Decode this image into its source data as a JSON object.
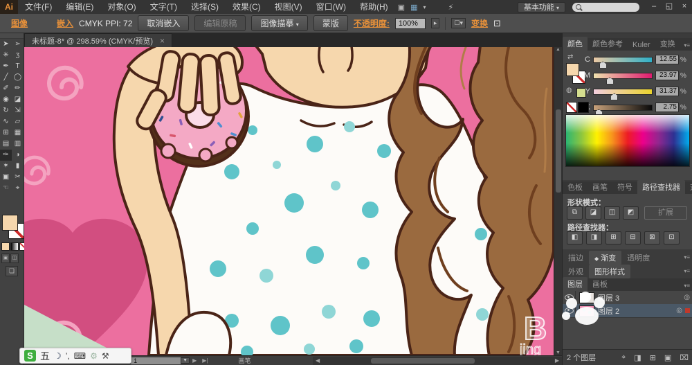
{
  "theme": {
    "bg-menubar": "#343434",
    "bg-controlbar": "#4e4e4e",
    "bg-toolbar": "#424242",
    "bg-panel": "#464646",
    "bg-canvas-frame": "#2b2b2b",
    "accent-orange": "#e8913a",
    "text-light": "#d6d6d6",
    "selection-blue": "#4a5866",
    "ill-pink": "#ec6f9f",
    "ill-pink-light": "#f4a3c0",
    "ill-pink-deep": "#d24e80",
    "ill-mint": "#c6dfc8",
    "ill-skin": "#f6d7ad",
    "ill-outline": "#4a2417",
    "ill-choco": "#53301a",
    "ill-frosting": "#f4a9c5",
    "ill-teal": "#5fc4c9",
    "ill-hair": "#9a6a3f",
    "ill-hair-dark": "#6f3f1f",
    "ill-hair-light": "#b07c48"
  },
  "titlebar": {
    "logo": "Ai",
    "menus": [
      "文件(F)",
      "编辑(E)",
      "对象(O)",
      "文字(T)",
      "选择(S)",
      "效果(C)",
      "视图(V)",
      "窗口(W)",
      "帮助(H)"
    ],
    "launch_bridge_icon": "▣",
    "arrange_documents_icon": "▦",
    "arrange_caret": "▾",
    "performance_icon": "⚡",
    "workspace": "基本功能",
    "workspace_caret": "▾",
    "minimize": "–",
    "restore": "◱",
    "close": "×"
  },
  "controlbar": {
    "selection_type": "图像",
    "embed": "嵌入",
    "color_info": "CMYK  PPI: 72",
    "unembed": "取消嵌入",
    "edit_original": "编辑原稿",
    "image_trace": "图像描摹",
    "trace_caret": "▾",
    "mask": "蒙版",
    "opacity_label": "不透明度:",
    "opacity_value": "100%",
    "opacity_caret": "▸",
    "select_similar_icon": "☐",
    "select_similar_caret": "▾",
    "transform": "变换",
    "isolate_icon": "⊡"
  },
  "document_tab": {
    "title": "未标题-8* @ 298.59% (CMYK/预览)",
    "close": "×"
  },
  "tools": [
    {
      "name": "selection-tool",
      "glyph": "➤"
    },
    {
      "name": "direct-selection-tool",
      "glyph": "➢"
    },
    {
      "name": "magic-wand-tool",
      "glyph": "✳"
    },
    {
      "name": "lasso-tool",
      "glyph": "ʒ"
    },
    {
      "name": "pen-tool",
      "glyph": "✒"
    },
    {
      "name": "type-tool",
      "glyph": "T"
    },
    {
      "name": "line-segment-tool",
      "glyph": "╱"
    },
    {
      "name": "ellipse-tool",
      "glyph": "◯"
    },
    {
      "name": "paintbrush-tool",
      "glyph": "✐"
    },
    {
      "name": "pencil-tool",
      "glyph": "✏"
    },
    {
      "name": "blob-brush-tool",
      "glyph": "◉"
    },
    {
      "name": "eraser-tool",
      "glyph": "◪"
    },
    {
      "name": "rotate-tool",
      "glyph": "↻"
    },
    {
      "name": "scale-tool",
      "glyph": "⇲"
    },
    {
      "name": "width-tool",
      "glyph": "∿"
    },
    {
      "name": "free-transform-tool",
      "glyph": "▱"
    },
    {
      "name": "shape-builder-tool",
      "glyph": "⊞"
    },
    {
      "name": "perspective-grid-tool",
      "glyph": "▦"
    },
    {
      "name": "mesh-tool",
      "glyph": "▤"
    },
    {
      "name": "gradient-tool",
      "glyph": "▥"
    },
    {
      "name": "eyedropper-tool",
      "glyph": "✑"
    },
    {
      "name": "blend-tool",
      "glyph": "◑"
    },
    {
      "name": "symbol-sprayer-tool",
      "glyph": "✶"
    },
    {
      "name": "column-graph-tool",
      "glyph": "▮"
    },
    {
      "name": "artboard-tool",
      "glyph": "▣"
    },
    {
      "name": "slice-tool",
      "glyph": "✂"
    },
    {
      "name": "hand-tool",
      "glyph": "☜"
    },
    {
      "name": "zoom-tool",
      "glyph": "⌖"
    }
  ],
  "color_panel": {
    "tabs": [
      "颜色",
      "颜色参考",
      "Kuler",
      "变换"
    ],
    "menu_icon": "▾≡",
    "swap_icon": "⇄",
    "web_icon": "◍",
    "channels": [
      {
        "label": "C",
        "value": "12.55"
      },
      {
        "label": "M",
        "value": "23.97"
      },
      {
        "label": "Y",
        "value": "31.37"
      },
      {
        "label": "K",
        "value": "2.75"
      }
    ],
    "unit": "%"
  },
  "pathfinder_panel": {
    "tabs": [
      "色板",
      "画笔",
      "符号",
      "路径查找器",
      "对齐"
    ],
    "menu_icon": "▾≡",
    "shape_modes_label": "形状模式：",
    "shape_modes": [
      {
        "name": "unite",
        "glyph": "⧉"
      },
      {
        "name": "minus-front",
        "glyph": "◪"
      },
      {
        "name": "intersect",
        "glyph": "◫"
      },
      {
        "name": "exclude",
        "glyph": "◩"
      }
    ],
    "expand": "扩展",
    "pathfinders_label": "路径查找器：",
    "pathfinders": [
      {
        "name": "divide",
        "glyph": "◧"
      },
      {
        "name": "trim",
        "glyph": "◨"
      },
      {
        "name": "merge",
        "glyph": "⊞"
      },
      {
        "name": "crop",
        "glyph": "⊟"
      },
      {
        "name": "outline",
        "glyph": "⊠"
      },
      {
        "name": "minus-back",
        "glyph": "⊡"
      }
    ]
  },
  "stroke_row": {
    "tabs": [
      "描边",
      "渐变",
      "透明度"
    ],
    "gradient_icon": "◆",
    "menu_icon": "▾≡"
  },
  "appearance_row": {
    "tabs": [
      "外观",
      "图形样式"
    ],
    "menu_icon": "▾≡"
  },
  "layers_panel": {
    "tabs": [
      "图层",
      "画板"
    ],
    "menu_icon": "▾≡",
    "target_icon": "◎",
    "layers": [
      {
        "name": "图层 3"
      },
      {
        "name": "图层 2"
      }
    ],
    "count": "2 个图层",
    "buttons": [
      {
        "name": "locate-object",
        "glyph": "⌖"
      },
      {
        "name": "make-clipping-mask",
        "glyph": "◨"
      },
      {
        "name": "new-sublayer",
        "glyph": "⊞"
      },
      {
        "name": "new-layer",
        "glyph": "▣"
      },
      {
        "name": "delete-selection",
        "glyph": "⌧"
      }
    ]
  },
  "status_bar": {
    "artboard_prev": "◀",
    "artboard_value": "1",
    "artboard_caret": "▼",
    "artboard_next": "▶",
    "artboard_last": "▶|",
    "tool_name": "画笔",
    "scroll_left": "◀",
    "scroll_right": "▶",
    "vscroll_up": "▲",
    "vscroll_down": "▼"
  },
  "ime_bar": {
    "logo": "S",
    "mode": "五",
    "icons": [
      {
        "name": "moon-icon",
        "glyph": "☽"
      },
      {
        "name": "punctuation-icon",
        "glyph": "’,"
      },
      {
        "name": "keyboard-icon",
        "glyph": "⌨"
      },
      {
        "name": "settings-icon",
        "glyph": "⚙"
      },
      {
        "name": "wrench-icon",
        "glyph": "⚒"
      }
    ]
  },
  "watermark": {
    "line1": "B",
    "line2": "jing"
  }
}
